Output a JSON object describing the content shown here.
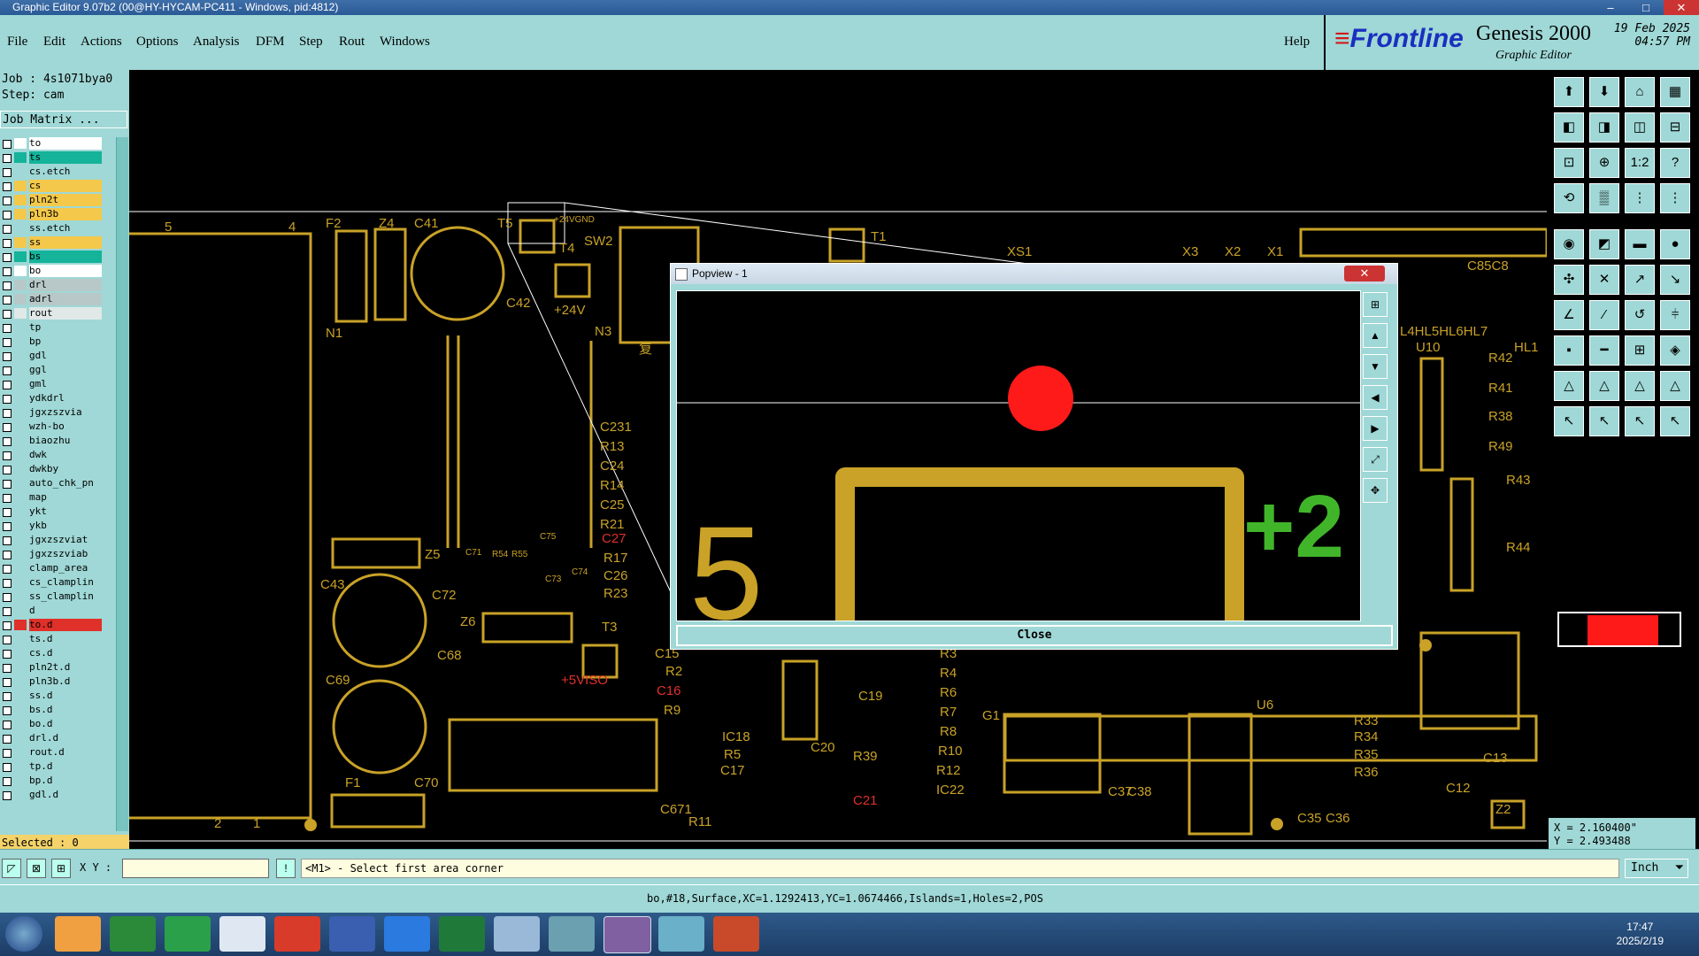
{
  "window": {
    "title": "Graphic Editor 9.07b2 (00@HY-HYCAM-PC411 - Windows, pid:4812)",
    "minimize": "–",
    "maximize": "□",
    "close": "✕"
  },
  "menu": [
    "File",
    "Edit",
    "Actions",
    "Options",
    "Analysis",
    "DFM",
    "Step",
    "Rout",
    "Windows"
  ],
  "help": "Help",
  "brand": {
    "logo": "Frontline",
    "product": "Genesis 2000",
    "subtitle": "Graphic Editor",
    "date": "19 Feb 2025",
    "time": "04:57 PM"
  },
  "job": {
    "job_line": "Job : 4s1071bya0",
    "step_line": "Step: cam",
    "matrix_button": "Job Matrix ..."
  },
  "layers": [
    {
      "name": "to",
      "color": "#ffffff"
    },
    {
      "name": "ts",
      "color": "#14b39a"
    },
    {
      "name": "cs.etch",
      "color": "#9fd8d6"
    },
    {
      "name": "cs",
      "color": "#f4c84a"
    },
    {
      "name": "pln2t",
      "color": "#f4c84a"
    },
    {
      "name": "pln3b",
      "color": "#f4c84a"
    },
    {
      "name": "ss.etch",
      "color": "#9fd8d6"
    },
    {
      "name": "ss",
      "color": "#f4c84a"
    },
    {
      "name": "bs",
      "color": "#14b39a"
    },
    {
      "name": "bo",
      "color": "#ffffff"
    },
    {
      "name": "drl",
      "color": "#b8c8c8"
    },
    {
      "name": "adrl",
      "color": "#b8c8c8"
    },
    {
      "name": "rout",
      "color": "#e0e8e8"
    },
    {
      "name": "tp",
      "color": "#9fd8d6"
    },
    {
      "name": "bp",
      "color": "#9fd8d6"
    },
    {
      "name": "gdl",
      "color": "#9fd8d6"
    },
    {
      "name": "ggl",
      "color": "#9fd8d6"
    },
    {
      "name": "gml",
      "color": "#9fd8d6"
    },
    {
      "name": "ydkdrl",
      "color": "#9fd8d6"
    },
    {
      "name": "jgxzszvia",
      "color": "#9fd8d6"
    },
    {
      "name": "wzh-bo",
      "color": "#9fd8d6"
    },
    {
      "name": "biaozhu",
      "color": "#9fd8d6"
    },
    {
      "name": "dwk",
      "color": "#9fd8d6"
    },
    {
      "name": "dwkby",
      "color": "#9fd8d6"
    },
    {
      "name": "auto_chk_pn",
      "color": "#9fd8d6"
    },
    {
      "name": "map",
      "color": "#9fd8d6"
    },
    {
      "name": "ykt",
      "color": "#9fd8d6"
    },
    {
      "name": "ykb",
      "color": "#9fd8d6"
    },
    {
      "name": "jgxzszviat",
      "color": "#9fd8d6"
    },
    {
      "name": "jgxzszviab",
      "color": "#9fd8d6"
    },
    {
      "name": "clamp_area",
      "color": "#9fd8d6"
    },
    {
      "name": "cs_clamplin",
      "color": "#9fd8d6"
    },
    {
      "name": "ss_clamplin",
      "color": "#9fd8d6"
    },
    {
      "name": "d",
      "color": "#9fd8d6"
    },
    {
      "name": "to.d",
      "color": "#e0302a"
    },
    {
      "name": "ts.d",
      "color": "#9fd8d6"
    },
    {
      "name": "cs.d",
      "color": "#9fd8d6"
    },
    {
      "name": "pln2t.d",
      "color": "#9fd8d6"
    },
    {
      "name": "pln3b.d",
      "color": "#9fd8d6"
    },
    {
      "name": "ss.d",
      "color": "#9fd8d6"
    },
    {
      "name": "bs.d",
      "color": "#9fd8d6"
    },
    {
      "name": "bo.d",
      "color": "#9fd8d6"
    },
    {
      "name": "drl.d",
      "color": "#9fd8d6"
    },
    {
      "name": "rout.d",
      "color": "#9fd8d6"
    },
    {
      "name": "tp.d",
      "color": "#9fd8d6"
    },
    {
      "name": "bp.d",
      "color": "#9fd8d6"
    },
    {
      "name": "gdl.d",
      "color": "#9fd8d6"
    }
  ],
  "selected": "Selected : 0",
  "canvas_labels": [
    "5",
    "4",
    "F2",
    "Z4",
    "C41",
    "T5",
    "+24VGND",
    "SW2",
    "T1",
    "XS1",
    "X3",
    "X2",
    "X1",
    "C85C8",
    "T4",
    "+24V",
    "N1",
    "N3",
    "C42",
    "L4HL5HL6HL7",
    "U10",
    "HL1",
    "R42",
    "R41",
    "R38",
    "R49",
    "R43",
    "R44",
    "C231",
    "R13",
    "C24",
    "R14",
    "C25",
    "R21",
    "C27",
    "R17",
    "C26",
    "R23",
    "Z5",
    "C72",
    "C43",
    "Z6",
    "C68",
    "T3",
    "C69",
    "+5VISO",
    "R2",
    "C16",
    "R9",
    "C19",
    "R4",
    "R6",
    "R7",
    "R8",
    "R10",
    "R12",
    "IC22",
    "G1",
    "U6",
    "R33",
    "R34",
    "R35",
    "R36",
    "C13",
    "C12",
    "Z2",
    "IC18",
    "R5",
    "C17",
    "C20",
    "R39",
    "C21",
    "C37",
    "C38",
    "C35",
    "C36",
    "F1",
    "C70",
    "C671",
    "R11",
    "2",
    "1",
    "C71",
    "R54",
    "R55",
    "C75",
    "C73",
    "C74",
    "R3",
    "C15",
    "复"
  ],
  "popview": {
    "title": "Popview - 1",
    "close_label": "Close",
    "labels": [
      "5",
      "+2"
    ],
    "title_close": "✕"
  },
  "coords": {
    "x": "X = 2.160400\"",
    "y": "Y = 2.493488"
  },
  "input": {
    "xy_label": "X Y :",
    "xy_value": "",
    "prompt": "<M1> - Select first area corner",
    "units": "Inch"
  },
  "status": "bo,#18,Surface,XC=1.1292413,YC=1.0674466,Islands=1,Holes=2,POS",
  "clock": {
    "time": "17:47",
    "date": "2025/2/19"
  },
  "colors": {
    "copper": "#c9a227",
    "panel": "#9fd8d6",
    "highlight": "#ff1a1a"
  }
}
